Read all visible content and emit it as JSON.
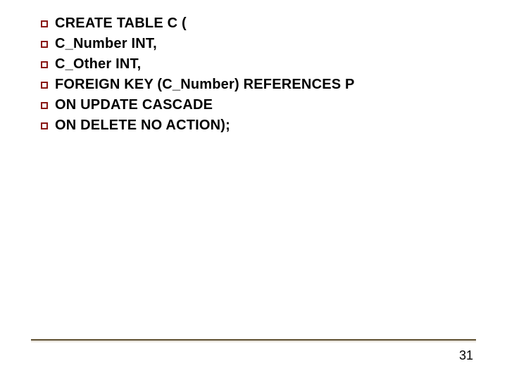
{
  "bullet_color": "#8a1714",
  "lines": [
    "CREATE TABLE C (",
    "C_Number INT,",
    "C_Other INT,",
    "FOREIGN KEY (C_Number) REFERENCES P",
    "ON UPDATE CASCADE",
    "ON DELETE NO ACTION);"
  ],
  "page_number": "31"
}
